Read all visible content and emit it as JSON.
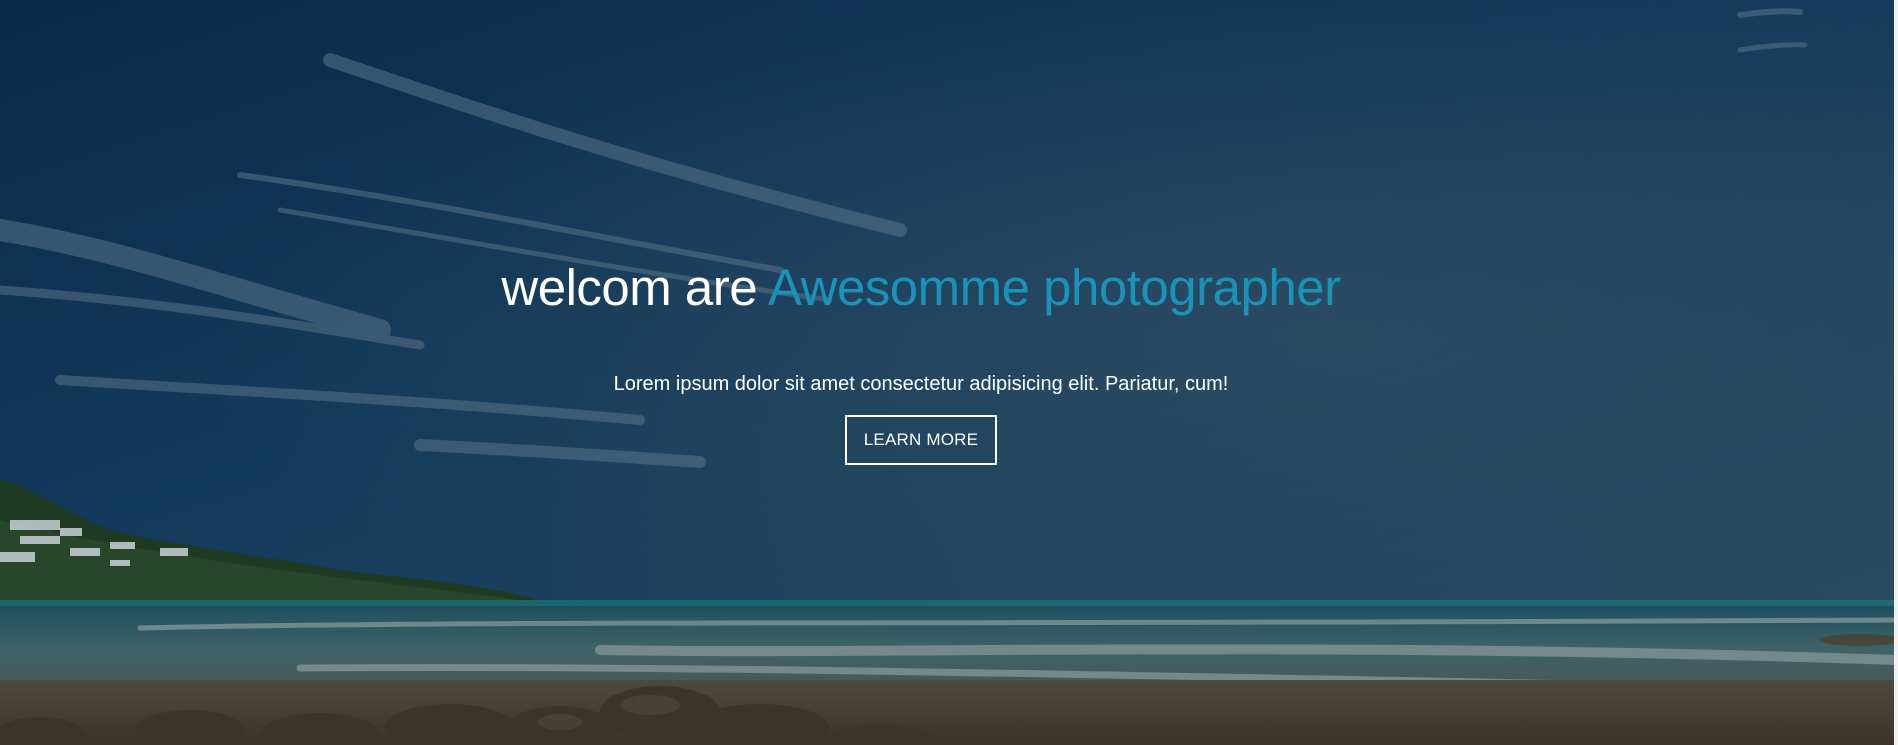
{
  "hero": {
    "headline_white": "welcom are",
    "headline_accent": "Awesomme photographer",
    "tagline": "Lorem ipsum dolor sit amet consectetur adipisicing elit. Pariatur, cum!",
    "button_label": "LEARN MORE"
  },
  "theme": {
    "accent": "#1a93b8",
    "text": "#ffffff",
    "overlay": "#0b2a45"
  },
  "background": {
    "scene": "beach-seascape-photo"
  }
}
